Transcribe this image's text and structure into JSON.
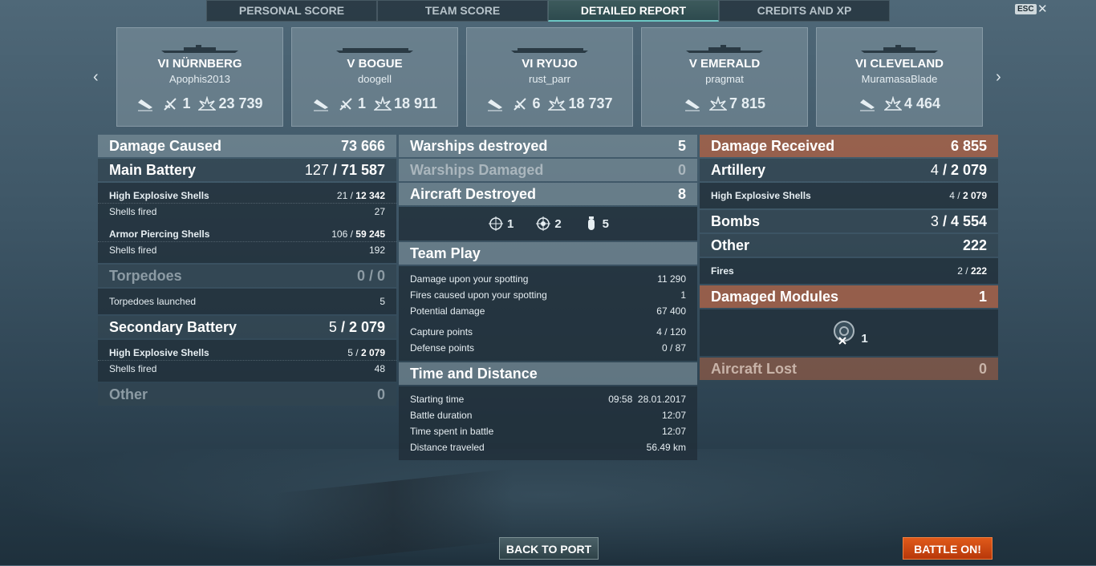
{
  "tabs": [
    "PERSONAL SCORE",
    "TEAM SCORE",
    "DETAILED REPORT",
    "CREDITS AND XP"
  ],
  "esc_label": "ESC",
  "close_glyph": "✕",
  "nav": {
    "prev": "‹",
    "next": "›"
  },
  "cards": [
    {
      "name": "VI NÜRNBERG",
      "player": "Apophis2013",
      "planes": "1",
      "damage": "23 739"
    },
    {
      "name": "V BOGUE",
      "player": "doogell",
      "planes": "1",
      "damage": "18 911"
    },
    {
      "name": "VI RYUJO",
      "player": "rust_parr",
      "planes": "6",
      "damage": "18 737"
    },
    {
      "name": "V EMERALD",
      "player": "pragmat",
      "damage": "7 815"
    },
    {
      "name": "VI CLEVELAND",
      "player": "MuramasaBlade",
      "damage": "4 464"
    }
  ],
  "left": {
    "damage_caused": {
      "label": "Damage Caused",
      "value": "73 666"
    },
    "main_battery": {
      "label": "Main Battery",
      "hits": "127",
      "value": "71 587"
    },
    "he": {
      "label": "High Explosive Shells",
      "hits": "21",
      "value": "12 342"
    },
    "he_fired": {
      "label": "Shells fired",
      "value": "27"
    },
    "ap": {
      "label": "Armor Piercing Shells",
      "hits": "106",
      "value": "59 245"
    },
    "ap_fired": {
      "label": "Shells fired",
      "value": "192"
    },
    "torpedoes": {
      "label": "Torpedoes",
      "value": "0 / 0"
    },
    "torp_launched": {
      "label": "Torpedoes launched",
      "value": "5"
    },
    "secondary": {
      "label": "Secondary Battery",
      "hits": "5",
      "value": "2 079"
    },
    "sec_he": {
      "label": "High Explosive Shells",
      "hits": "5",
      "value": "2 079"
    },
    "sec_fired": {
      "label": "Shells fired",
      "value": "48"
    },
    "other": {
      "label": "Other",
      "value": "0"
    }
  },
  "middle": {
    "warships_destroyed": {
      "label": "Warships destroyed",
      "value": "5"
    },
    "warships_damaged": {
      "label": "Warships Damaged",
      "value": "0"
    },
    "aircraft_destroyed": {
      "label": "Aircraft Destroyed",
      "value": "8"
    },
    "aircraft_icons": [
      "1",
      "2",
      "5"
    ],
    "team_play": {
      "label": "Team Play"
    },
    "spotting_damage": {
      "label": "Damage upon your spotting",
      "value": "11 290"
    },
    "spotting_fires": {
      "label": "Fires caused upon your spotting",
      "value": "1"
    },
    "potential": {
      "label": "Potential damage",
      "value": "67 400"
    },
    "capture": {
      "label": "Capture points",
      "value": "4 / 120"
    },
    "defense": {
      "label": "Defense points",
      "value": "0 / 87"
    },
    "time_distance": {
      "label": "Time and Distance"
    },
    "start": {
      "label": "Starting time",
      "value": "09:58  28.01.2017"
    },
    "duration": {
      "label": "Battle duration",
      "value": "12:07"
    },
    "time_spent": {
      "label": "Time spent in battle",
      "value": "12:07"
    },
    "distance": {
      "label": "Distance traveled",
      "value": "56.49 km"
    }
  },
  "right": {
    "damage_received": {
      "label": "Damage Received",
      "value": "6 855"
    },
    "artillery": {
      "label": "Artillery",
      "hits": "4",
      "value": "2 079"
    },
    "he": {
      "label": "High Explosive Shells",
      "hits": "4",
      "value": "2 079"
    },
    "bombs": {
      "label": "Bombs",
      "hits": "3",
      "value": "4 554"
    },
    "other": {
      "label": "Other",
      "value": "222"
    },
    "fires": {
      "label": "Fires",
      "hits": "2",
      "value": "222"
    },
    "damaged_modules": {
      "label": "Damaged Modules",
      "value": "1"
    },
    "module_count": "1",
    "aircraft_lost": {
      "label": "Aircraft Lost",
      "value": "0"
    }
  },
  "buttons": {
    "back": "BACK TO PORT",
    "battle": "BATTLE ON!"
  }
}
